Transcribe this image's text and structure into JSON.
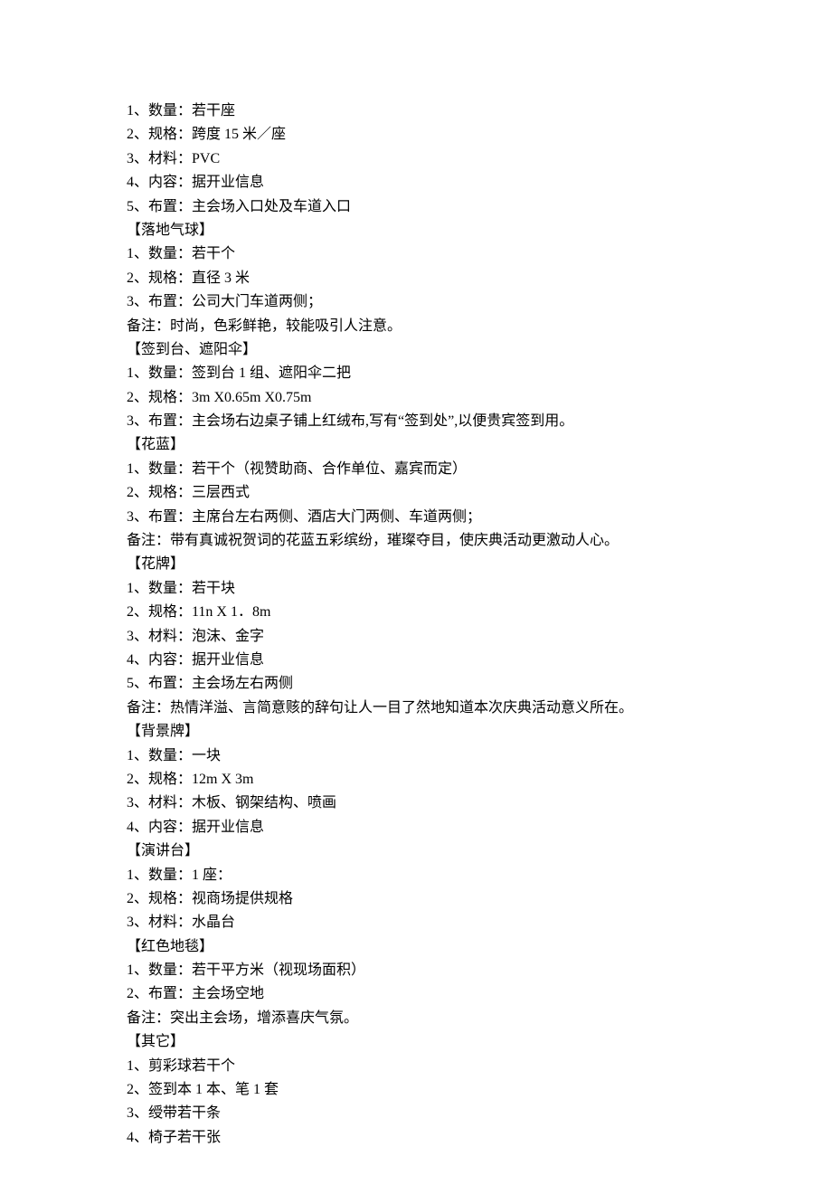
{
  "lines": [
    "1、数量：若干座",
    "2、规格：跨度 15 米／座",
    "3、材料：PVC",
    "4、内容：据开业信息",
    "5、布置：主会场入口处及车道入口",
    "【落地气球】",
    "1、数量：若干个",
    "2、规格：直径 3 米",
    "3、布置：公司大门车道两侧；",
    "备注：时尚，色彩鲜艳，较能吸引人注意。",
    "【签到台、遮阳伞】",
    "1、数量：签到台 1 组、遮阳伞二把",
    "2、规格：3m X0.65m X0.75m",
    "3、布置：主会场右边桌子铺上红绒布,写有“签到处”,以便贵宾签到用。",
    "【花蓝】",
    "1、数量：若干个（视赞助商、合作单位、嘉宾而定）",
    "2、规格：三层西式",
    "3、布置：主席台左右两侧、酒店大门两侧、车道两侧；",
    "备注：带有真诚祝贺词的花蓝五彩缤纷，璀璨夺目，使庆典活动更激动人心。",
    "【花牌】",
    "1、数量：若干块",
    "2、规格：11n X 1．8m",
    "3、材料：泡沫、金字",
    "4、内容：据开业信息",
    "5、布置：主会场左右两侧",
    "备注：热情洋溢、言简意赅的辞句让人一目了然地知道本次庆典活动意义所在。",
    "【背景牌】",
    "1、数量：一块",
    "2、规格：12m X 3m",
    "3、材料：木板、钢架结构、喷画",
    "4、内容：据开业信息",
    "【演讲台】",
    "1、数量：1 座：",
    "2、规格：视商场提供规格",
    "3、材料：水晶台",
    "【红色地毯】",
    "1、数量：若干平方米（视现场面积）",
    "2、布置：主会场空地",
    "备注：突出主会场，增添喜庆气氛。",
    "【其它】",
    "1、剪彩球若干个",
    "2、签到本 1 本、笔 1 套",
    "3、绶带若干条",
    "4、椅子若干张"
  ]
}
